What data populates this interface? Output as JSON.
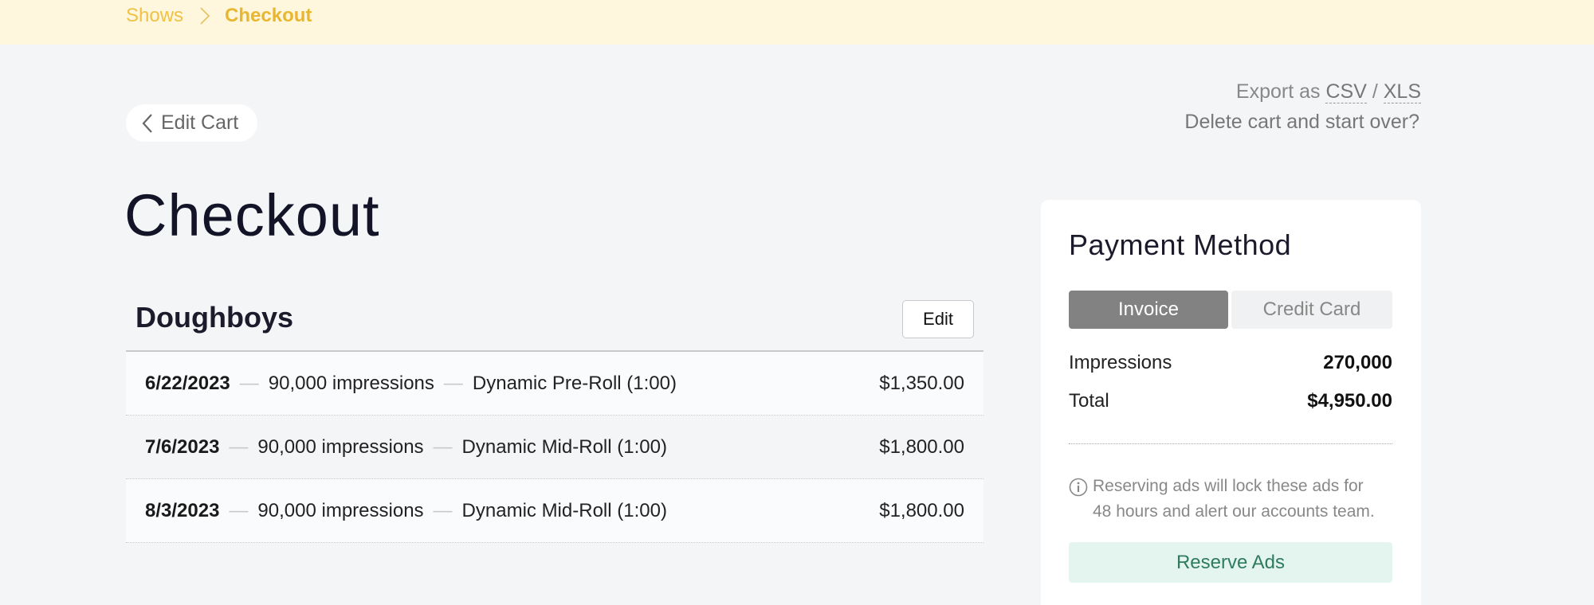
{
  "breadcrumb": {
    "parent": "Shows",
    "current": "Checkout"
  },
  "back": {
    "label": "Edit Cart"
  },
  "export": {
    "prefix": "Export as",
    "csv": "CSV",
    "separator": "/",
    "xls": "XLS"
  },
  "delete_cart": "Delete cart and start over?",
  "page_title": "Checkout",
  "show": {
    "name": "Doughboys",
    "edit_label": "Edit",
    "line_items": [
      {
        "date": "6/22/2023",
        "impressions": "90,000 impressions",
        "placement": "Dynamic Pre-Roll (1:00)",
        "price": "$1,350.00"
      },
      {
        "date": "7/6/2023",
        "impressions": "90,000 impressions",
        "placement": "Dynamic Mid-Roll (1:00)",
        "price": "$1,800.00"
      },
      {
        "date": "8/3/2023",
        "impressions": "90,000 impressions",
        "placement": "Dynamic Mid-Roll (1:00)",
        "price": "$1,800.00"
      }
    ]
  },
  "payment": {
    "title": "Payment Method",
    "options": [
      "Invoice",
      "Credit Card"
    ],
    "selected": "Invoice",
    "impressions_label": "Impressions",
    "impressions_value": "270,000",
    "total_label": "Total",
    "total_value": "$4,950.00",
    "notice_line1": "Reserving ads will lock these ads for",
    "notice_line2": "48 hours and alert our accounts team.",
    "reserve_label": "Reserve Ads"
  },
  "colors": {
    "topbar": "#fef7dd",
    "breadcrumb": "#efc246",
    "selected_toggle": "#828282",
    "reserve_bg": "#e4f5f0",
    "reserve_text": "#2e7b5e"
  },
  "icons": {
    "breadcrumb_separator": "chevron-right-icon",
    "back": "chevron-left-icon",
    "notice": "info-icon"
  }
}
